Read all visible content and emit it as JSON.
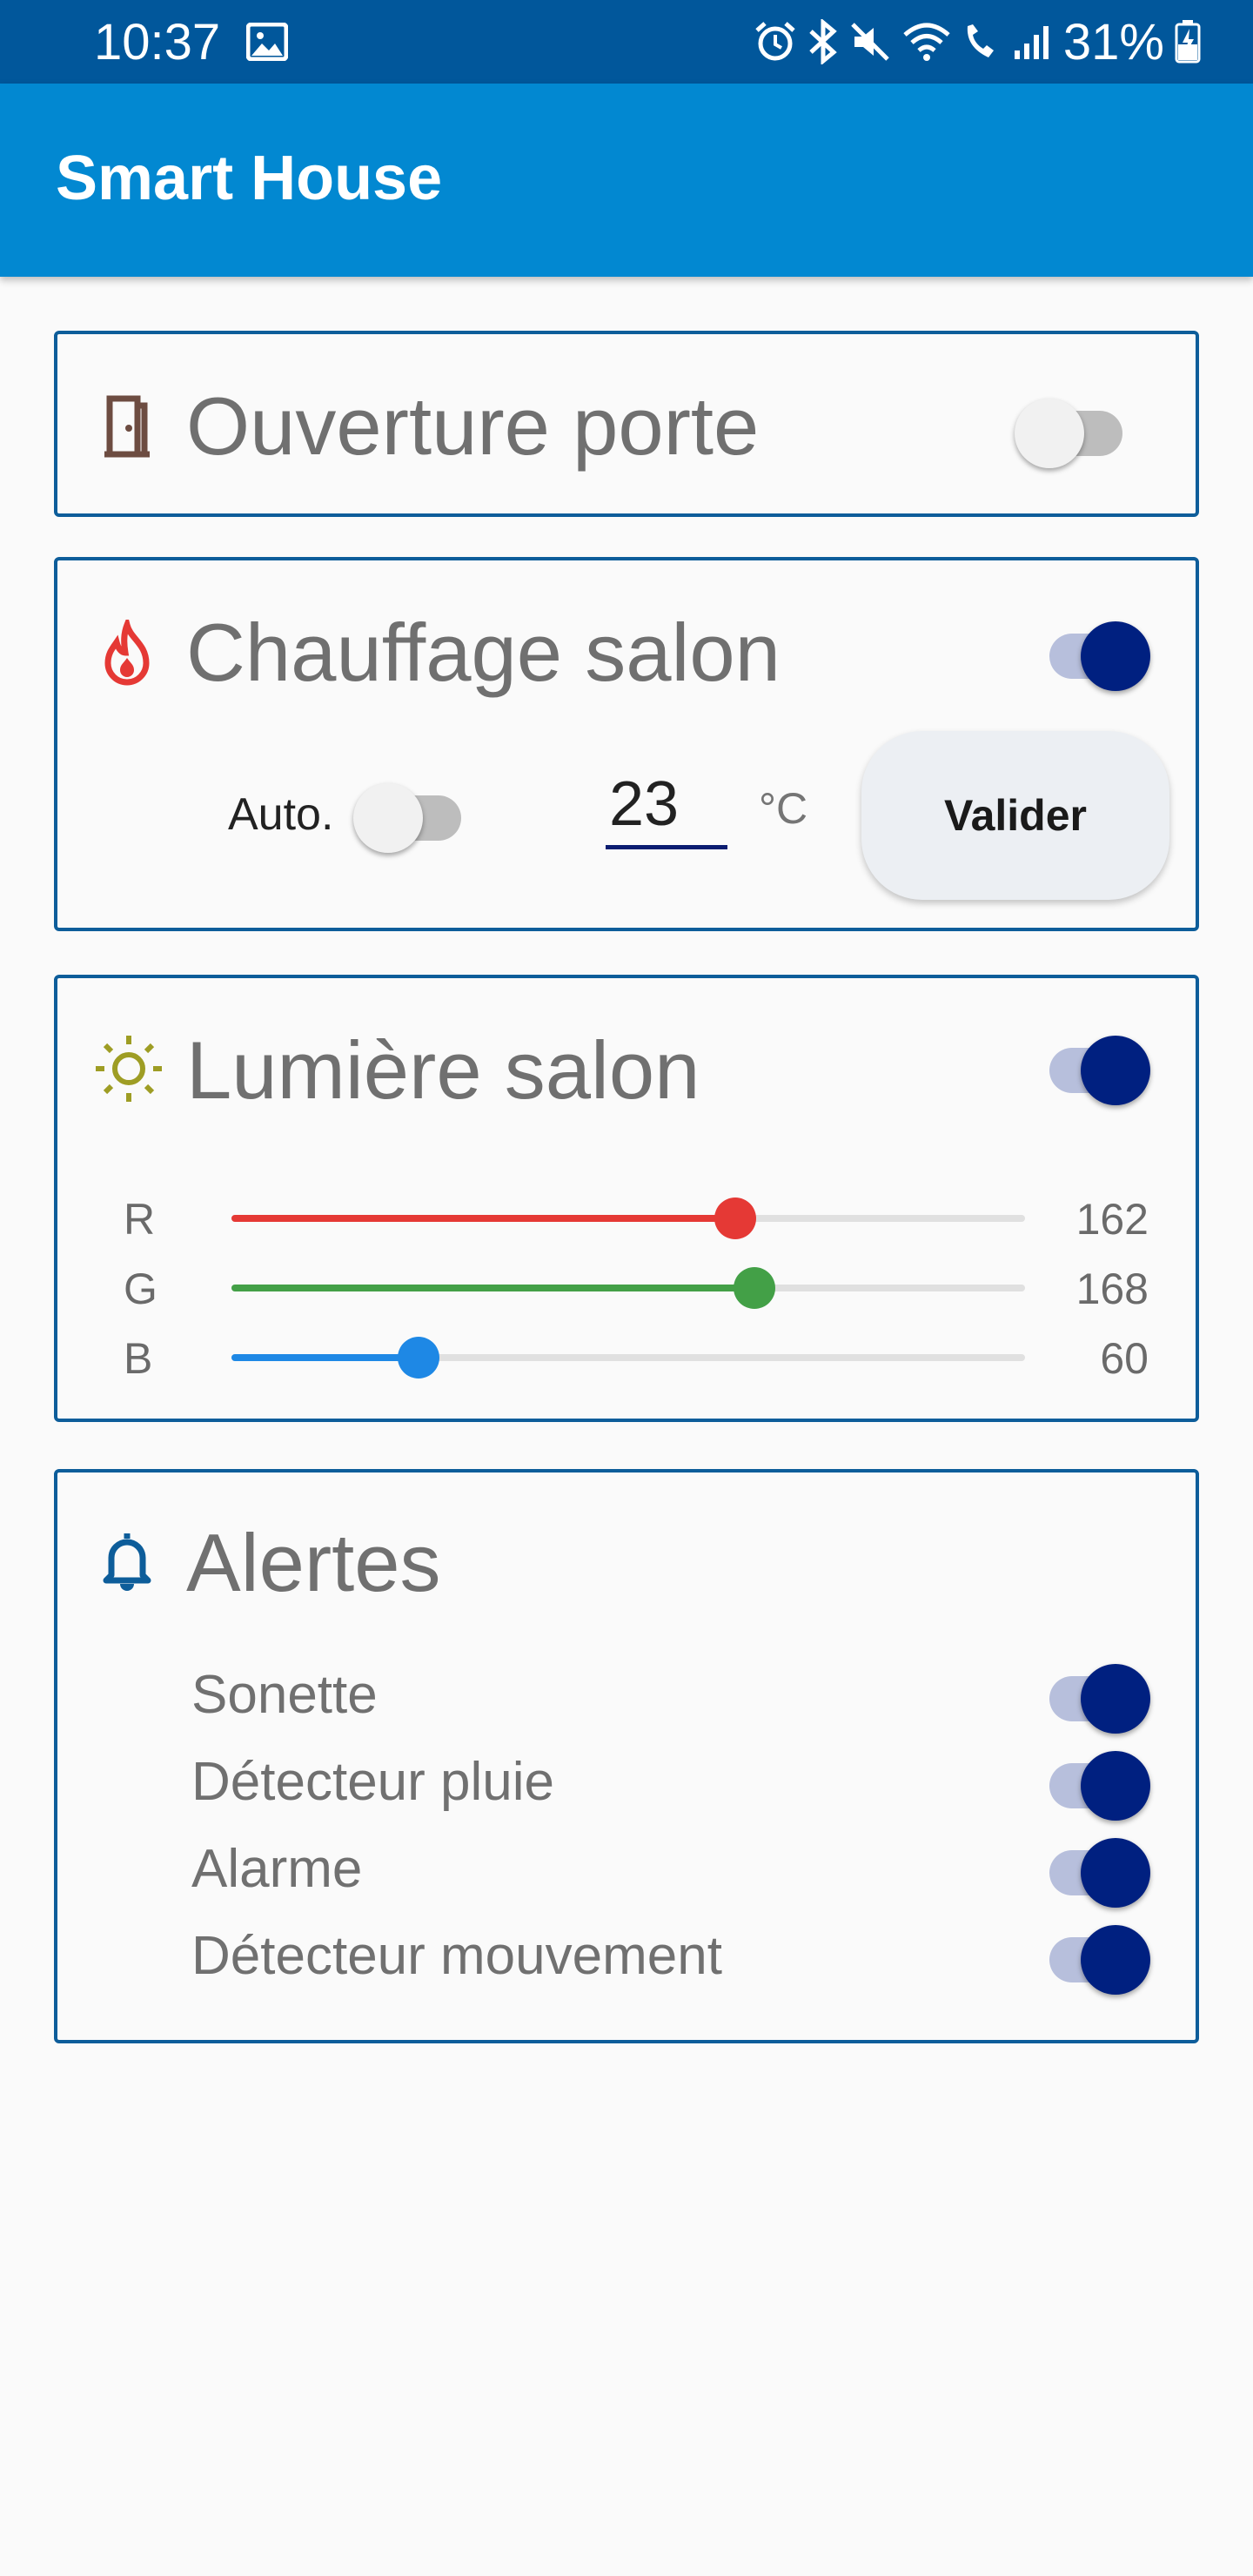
{
  "status_bar": {
    "time": "10:37",
    "battery": "31%",
    "icons": [
      "image-icon",
      "alarm-icon",
      "bluetooth-icon",
      "mute-icon",
      "wifi-icon",
      "wifi-calling-icon",
      "signal-icon",
      "battery-charging-icon"
    ]
  },
  "app_bar": {
    "title": "Smart House",
    "color": "#0288d1"
  },
  "door": {
    "title": "Ouverture porte",
    "icon": "door-icon",
    "enabled": false
  },
  "heating": {
    "title": "Chauffage salon",
    "icon": "fire-icon",
    "enabled": true,
    "auto_label": "Auto.",
    "auto_enabled": false,
    "temperature": "23",
    "unit": "°C",
    "submit_label": "Valider"
  },
  "light": {
    "title": "Lumière salon",
    "icon": "sun-icon",
    "enabled": true,
    "channels": [
      {
        "label": "R",
        "value": "162",
        "max": 255,
        "color": "#e53935"
      },
      {
        "label": "G",
        "value": "168",
        "max": 255,
        "color": "#43a047"
      },
      {
        "label": "B",
        "value": "60",
        "max": 255,
        "color": "#1e88e5"
      }
    ]
  },
  "alerts": {
    "title": "Alertes",
    "icon": "bell-icon",
    "items": [
      {
        "label": "Sonette",
        "enabled": true
      },
      {
        "label": "Détecteur pluie",
        "enabled": true
      },
      {
        "label": "Alarme",
        "enabled": true
      },
      {
        "label": "Détecteur mouvement",
        "enabled": true
      }
    ]
  },
  "colors": {
    "accent": "#002080",
    "card_border": "#0d5d9a",
    "status_bar": "#01579b"
  }
}
